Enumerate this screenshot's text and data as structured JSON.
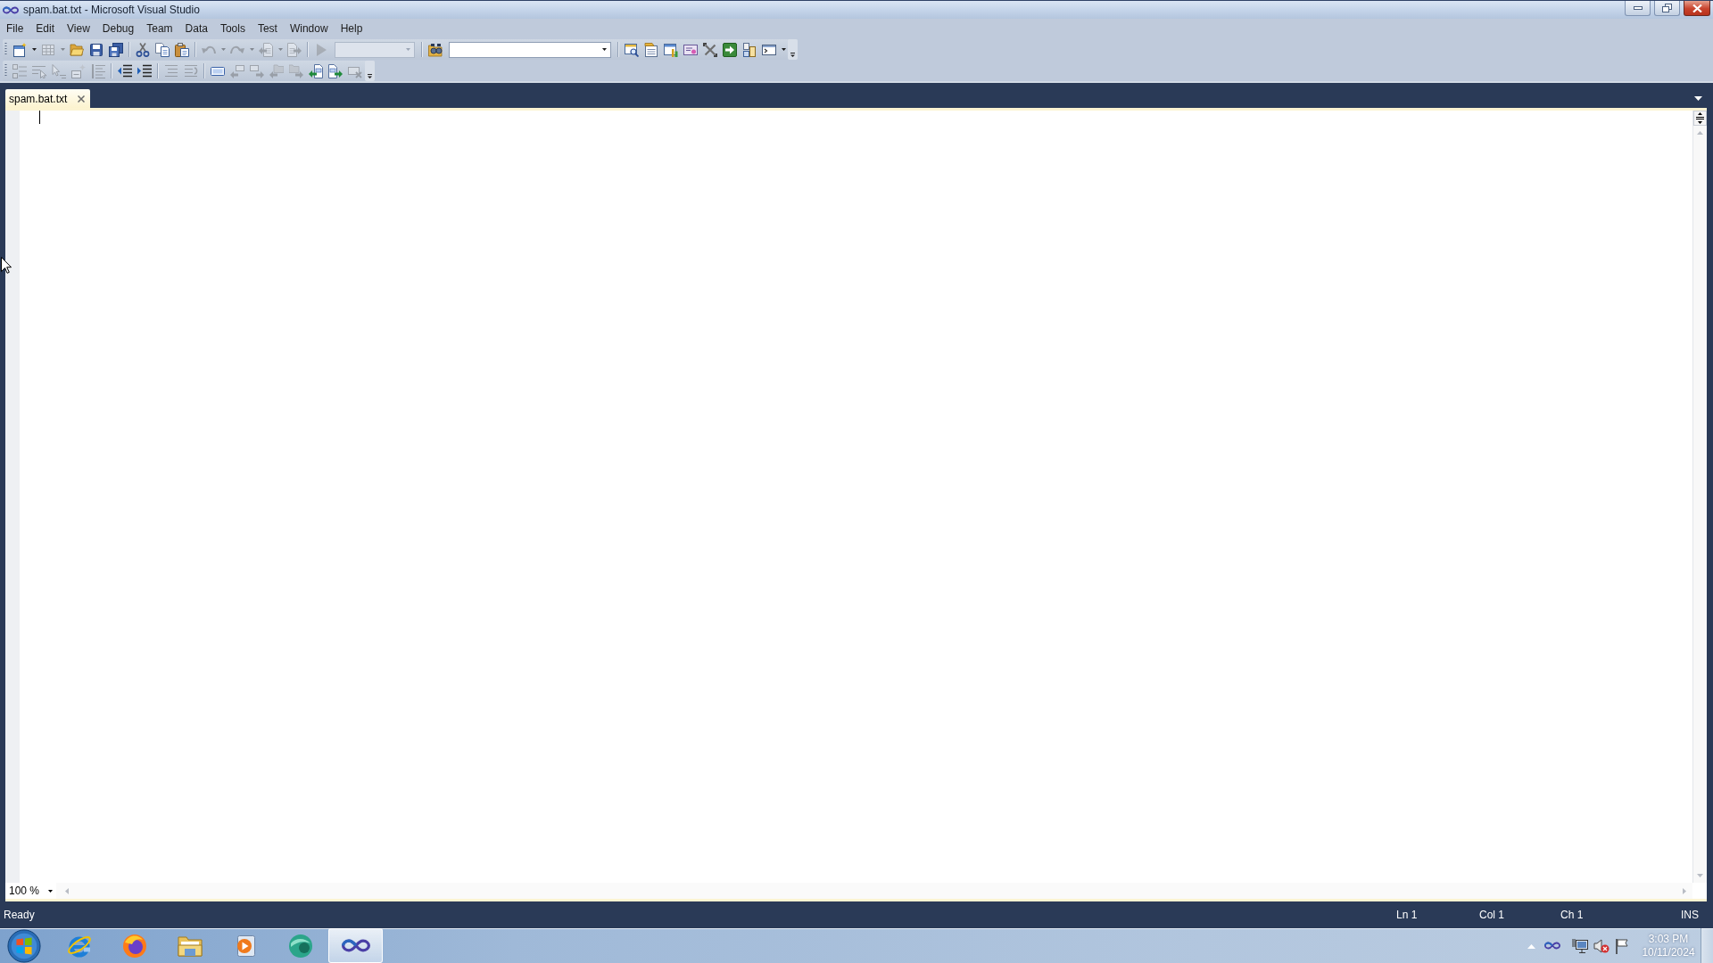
{
  "window": {
    "title": "spam.bat.txt - Microsoft Visual Studio"
  },
  "menu": [
    "File",
    "Edit",
    "View",
    "Debug",
    "Team",
    "Data",
    "Tools",
    "Test",
    "Window",
    "Help"
  ],
  "toolbars": [
    {
      "groups": [
        [
          {
            "kind": "split",
            "disabled": false
          },
          {
            "kind": "split",
            "disabled": true
          },
          {
            "kind": "button",
            "disabled": false
          },
          {
            "kind": "button",
            "disabled": false
          },
          {
            "kind": "button",
            "disabled": false
          }
        ],
        [
          {
            "kind": "button",
            "disabled": false
          },
          {
            "kind": "button",
            "disabled": false
          },
          {
            "kind": "button",
            "disabled": false
          }
        ],
        [
          {
            "kind": "split",
            "disabled": true
          },
          {
            "kind": "split",
            "disabled": true
          },
          {
            "kind": "split",
            "disabled": true
          },
          {
            "kind": "button",
            "disabled": true
          }
        ],
        [
          {
            "kind": "button",
            "disabled": true
          },
          {
            "kind": "combo",
            "disabled": true
          }
        ],
        [
          {
            "kind": "button",
            "disabled": false
          },
          {
            "kind": "combo",
            "disabled": false
          }
        ],
        [
          {
            "kind": "button",
            "disabled": false
          },
          {
            "kind": "button",
            "disabled": false
          },
          {
            "kind": "button",
            "disabled": false
          },
          {
            "kind": "button",
            "disabled": false
          },
          {
            "kind": "button",
            "disabled": false
          },
          {
            "kind": "button",
            "disabled": false
          },
          {
            "kind": "button",
            "disabled": false
          },
          {
            "kind": "split",
            "disabled": false
          }
        ]
      ]
    },
    {
      "groups": [
        [
          {
            "kind": "button",
            "disabled": true
          },
          {
            "kind": "button",
            "disabled": true
          },
          {
            "kind": "button",
            "disabled": true
          },
          {
            "kind": "button",
            "disabled": true
          },
          {
            "kind": "button",
            "disabled": true
          }
        ],
        [
          {
            "kind": "button",
            "disabled": false
          },
          {
            "kind": "button",
            "disabled": false
          }
        ],
        [
          {
            "kind": "button",
            "disabled": true
          },
          {
            "kind": "button",
            "disabled": true
          }
        ],
        [
          {
            "kind": "button",
            "disabled": false
          },
          {
            "kind": "button",
            "disabled": true
          },
          {
            "kind": "button",
            "disabled": true
          },
          {
            "kind": "button",
            "disabled": true
          },
          {
            "kind": "button",
            "disabled": true
          },
          {
            "kind": "button",
            "disabled": false
          },
          {
            "kind": "button",
            "disabled": false
          },
          {
            "kind": "button",
            "disabled": true
          }
        ]
      ]
    }
  ],
  "tabs": [
    {
      "label": "spam.bat.txt",
      "selected": true
    }
  ],
  "zoom": {
    "value": "100 %"
  },
  "status_bar": {
    "message": "Ready",
    "line": "Ln 1",
    "column": "Col 1",
    "character": "Ch 1",
    "mode": "INS"
  },
  "taskbar": {
    "apps": [
      {
        "selected": false
      },
      {
        "selected": false
      },
      {
        "selected": false
      },
      {
        "selected": false
      },
      {
        "selected": false
      },
      {
        "selected": true
      }
    ],
    "clock": {
      "time": "3:03 PM",
      "date": "10/11/2024"
    }
  }
}
